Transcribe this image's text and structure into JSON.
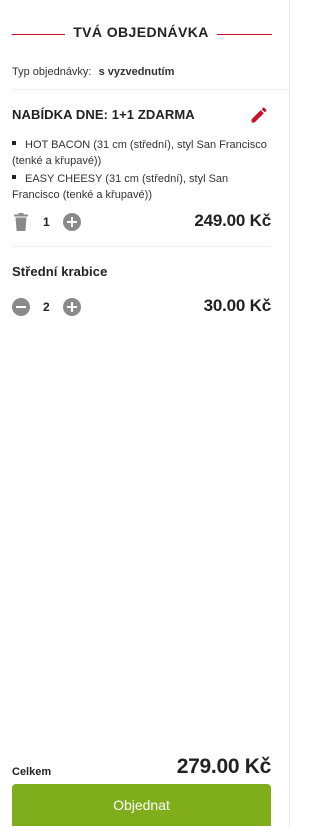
{
  "header": {
    "title": "TVÁ OBJEDNÁVKA"
  },
  "order_type": {
    "label": "Typ objednávky:",
    "value": "s vyzvednutím"
  },
  "items": [
    {
      "title": "NABÍDKA DNE: 1+1 ZDARMA",
      "details": [
        "HOT BACON (31 cm (střední), styl San Francisco (tenké a křupavé))",
        "EASY CHEESY (31 cm (střední), styl San Francisco (tenké a křupavé))"
      ],
      "quantity": "1",
      "price": "249.00 Kč",
      "edit_icon": "pencil-icon",
      "remove_icon": "trash-icon",
      "increase_icon": "plus-icon"
    },
    {
      "title": "Střední krabice",
      "quantity": "2",
      "price": "30.00 Kč",
      "decrease_icon": "minus-icon",
      "increase_icon": "plus-icon"
    }
  ],
  "summary": {
    "total_label": "Celkem",
    "total_value": "279.00 Kč"
  },
  "actions": {
    "order_label": "Objednat"
  },
  "colors": {
    "accent": "#c8102e",
    "primary_button": "#7fad1c",
    "icon_gray": "#8a8a8a"
  }
}
